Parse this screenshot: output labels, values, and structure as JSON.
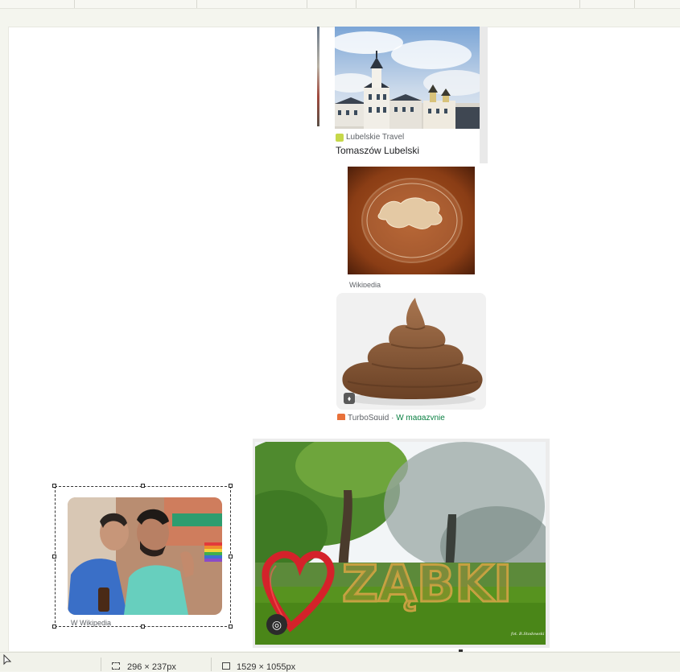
{
  "colors": {
    "source_green": "#0b8043",
    "text": "#202124",
    "muted": "#5f6368"
  },
  "results": {
    "tomaszow": {
      "source": "Lubelskie Travel",
      "title": "Tomaszów Lubelski",
      "source_icon": "lubelskie-travel-icon"
    },
    "petri": {
      "source": "Wikipedia"
    },
    "poop": {
      "source": "TurboSquid",
      "sep": " · ",
      "availability": "W magazynie",
      "badge_icon": "tag-icon"
    },
    "couple": {
      "source": "Wikipedia",
      "source_icon": "wikipedia-icon"
    },
    "zabki": {
      "sign_text": "ZĄBKI",
      "credit": "fot. B.Stodowski",
      "lens_icon": "camera-lens-icon"
    }
  },
  "statusbar": {
    "selection_icon": "selection-icon",
    "selection_size": "296 × 237px",
    "image_icon": "image-size-icon",
    "image_size": "1529 × 1055px"
  }
}
